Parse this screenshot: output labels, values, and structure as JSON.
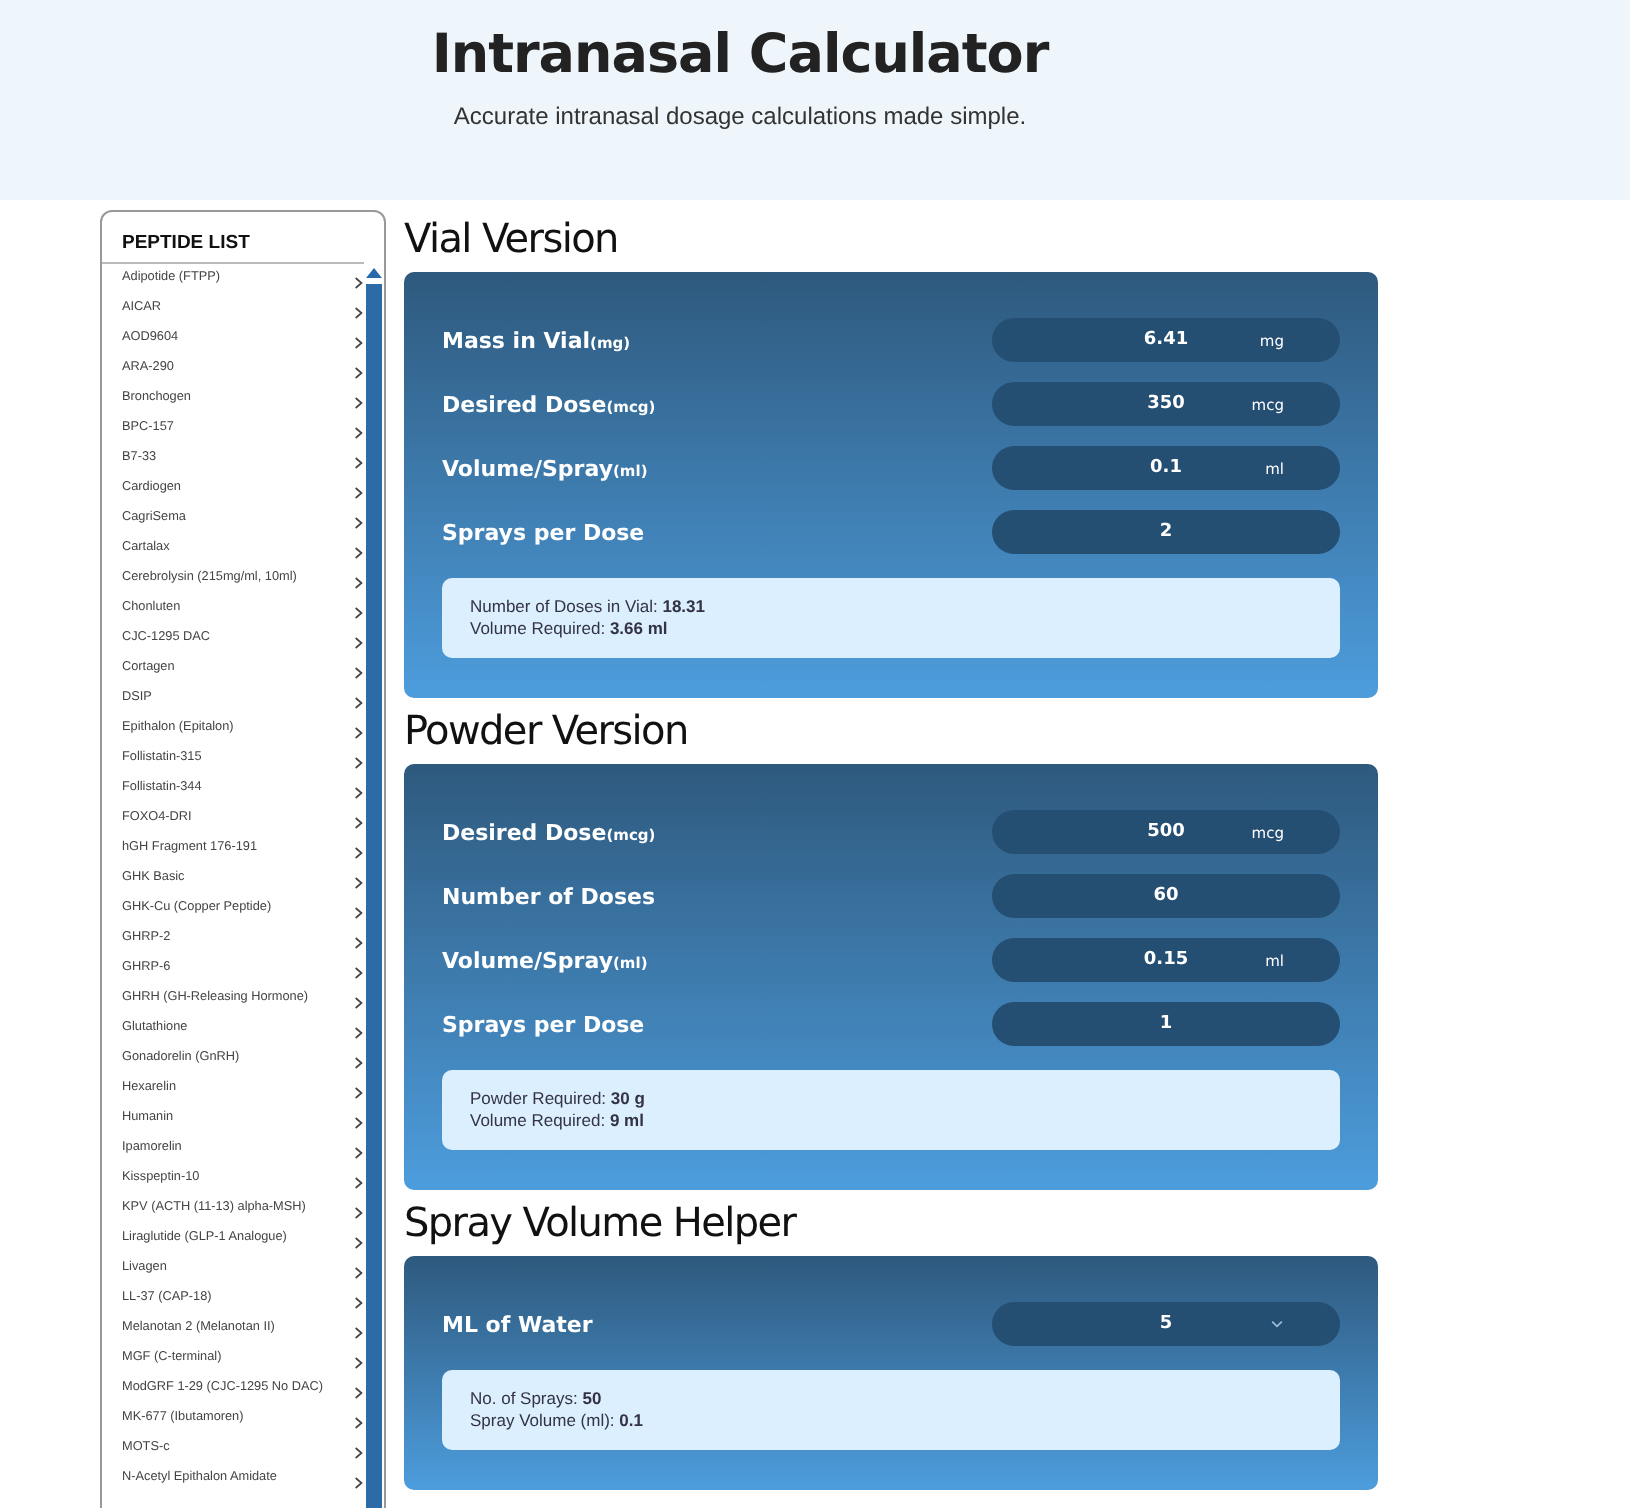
{
  "header": {
    "title": "Intranasal Calculator",
    "subtitle": "Accurate intranasal dosage calculations made simple."
  },
  "sidebar": {
    "title": "PEPTIDE LIST",
    "items": [
      "Adipotide (FTPP)",
      "AICAR",
      "AOD9604",
      "ARA-290",
      "Bronchogen",
      "BPC-157",
      "B7-33",
      "Cardiogen",
      "CagriSema",
      "Cartalax",
      "Cerebrolysin (215mg/ml, 10ml)",
      "Chonluten",
      "CJC-1295 DAC",
      "Cortagen",
      "DSIP",
      "Epithalon (Epitalon)",
      "Follistatin-315",
      "Follistatin-344",
      "FOXO4-DRI",
      "hGH Fragment 176-191",
      "GHK Basic",
      "GHK-Cu (Copper Peptide)",
      "GHRP-2",
      "GHRP-6",
      "GHRH (GH-Releasing Hormone)",
      "Glutathione",
      "Gonadorelin (GnRH)",
      "Hexarelin",
      "Humanin",
      "Ipamorelin",
      "Kisspeptin-10",
      "KPV (ACTH (11-13) alpha-MSH)",
      "Liraglutide (GLP-1 Analogue)",
      "Livagen",
      "LL-37 (CAP-18)",
      "Melanotan 2 (Melanotan II)",
      "MGF (C-terminal)",
      "ModGRF 1-29 (CJC-1295 No DAC)",
      "MK-677 (Ibutamoren)",
      "MOTS-c",
      "N-Acetyl Epithalon Amidate"
    ]
  },
  "sections": [
    {
      "title": "Vial Version",
      "rows": [
        {
          "label": "Mass in Vial",
          "unit_label": "(mg)",
          "kind": "input",
          "value": "6.41",
          "unit": "mg"
        },
        {
          "label": "Desired Dose",
          "unit_label": "(mcg)",
          "kind": "input",
          "value": "350",
          "unit": "mcg"
        },
        {
          "label": "Volume/Spray",
          "unit_label": "(ml)",
          "kind": "input",
          "value": "0.1",
          "unit": "ml"
        },
        {
          "label": "Sprays per Dose",
          "kind": "input",
          "value": "2"
        }
      ],
      "results": [
        "Number of Doses in Vial: **18.31**",
        "Volume Required: **3.66 ml**"
      ]
    },
    {
      "title": "Powder Version",
      "rows": [
        {
          "label": "Desired Dose",
          "unit_label": "(mcg)",
          "kind": "input",
          "value": "500",
          "unit": "mcg"
        },
        {
          "label": "Number of Doses",
          "kind": "input",
          "value": "60"
        },
        {
          "label": "Volume/Spray",
          "unit_label": "(ml)",
          "kind": "input",
          "value": "0.15",
          "unit": "ml"
        },
        {
          "label": "Sprays per Dose",
          "kind": "input",
          "value": "1"
        }
      ],
      "results": [
        "Powder Required: **30 g**",
        "Volume Required: **9 ml**"
      ]
    },
    {
      "title": "Spray Volume Helper",
      "rows": [
        {
          "label": "ML of Water",
          "kind": "select",
          "value": "5"
        }
      ],
      "results": [
        "No. of Sprays: **50**",
        "Spray Volume (ml): **0.1**"
      ]
    }
  ]
}
